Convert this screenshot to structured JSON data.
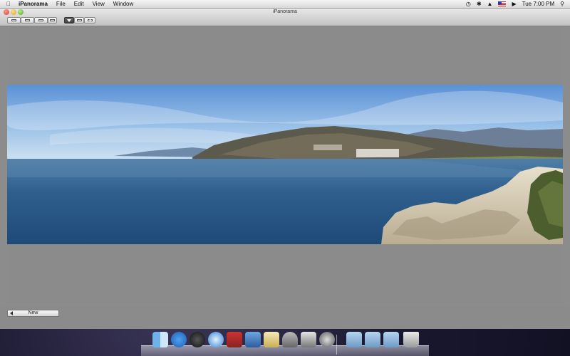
{
  "menubar": {
    "apple_icon": "apple-icon",
    "app_name": "iPanorama",
    "items": [
      "File",
      "Edit",
      "View",
      "Window"
    ],
    "status_icons": [
      "time-machine-icon",
      "bluetooth-icon",
      "wifi-icon",
      "flag-icon",
      "volume-icon"
    ],
    "clock": "Tue 7:00 PM",
    "spotlight_icon": "search-icon"
  },
  "window": {
    "title": "iPanorama",
    "toolbar_buttons": [
      "zoom-out-icon",
      "zoom-fit-icon",
      "actual-size-icon",
      "fit-width-icon"
    ],
    "tool_buttons": [
      "import-icon",
      "select-icon",
      "crop-icon"
    ],
    "bottom": {
      "new_label": "New"
    }
  },
  "dock": {
    "apps": [
      "finder-icon",
      "app-store-icon",
      "dashboard-icon",
      "safari-icon",
      "photo-booth-icon",
      "xcode-icon",
      "textedit-icon",
      "keychain-icon",
      "preview-icon",
      "disk-utility-icon"
    ],
    "folders": [
      "applications-folder-icon",
      "documents-folder-icon",
      "downloads-stack-icon",
      "trash-icon"
    ]
  },
  "colors": {
    "window_bg": "#8c8c8c",
    "sky_top": "#5f95d6",
    "sea": "#2f5c8c"
  }
}
